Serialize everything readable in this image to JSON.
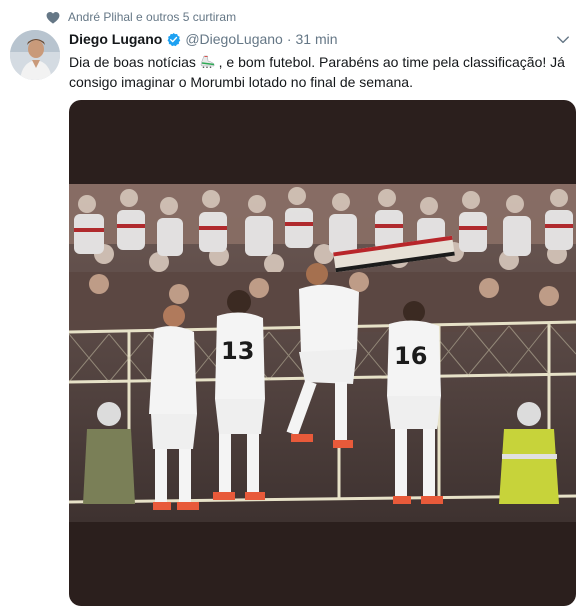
{
  "social_context": {
    "text": "André Plihal e outros 5 curtiram",
    "icon": "heart-icon"
  },
  "tweet": {
    "display_name": "Diego Lugano",
    "verified": true,
    "handle": "@DiegoLugano",
    "separator": "·",
    "time": "31 min",
    "text_before_emoji": "Dia de boas notícias ",
    "emoji": "soccer-boot-emoji",
    "text_after_emoji": " , e bom futebol. Parabéns ao time pela classificação! Já consigo imaginar o Morumbi lotado no final de semana."
  },
  "colors": {
    "accent": "#1da1f2",
    "muted": "#657786",
    "text": "#14171a",
    "media_bg": "#2b1f1d"
  },
  "media": {
    "description_icon": "photo-players-celebrating",
    "jersey_numbers": [
      "13",
      "16"
    ]
  }
}
